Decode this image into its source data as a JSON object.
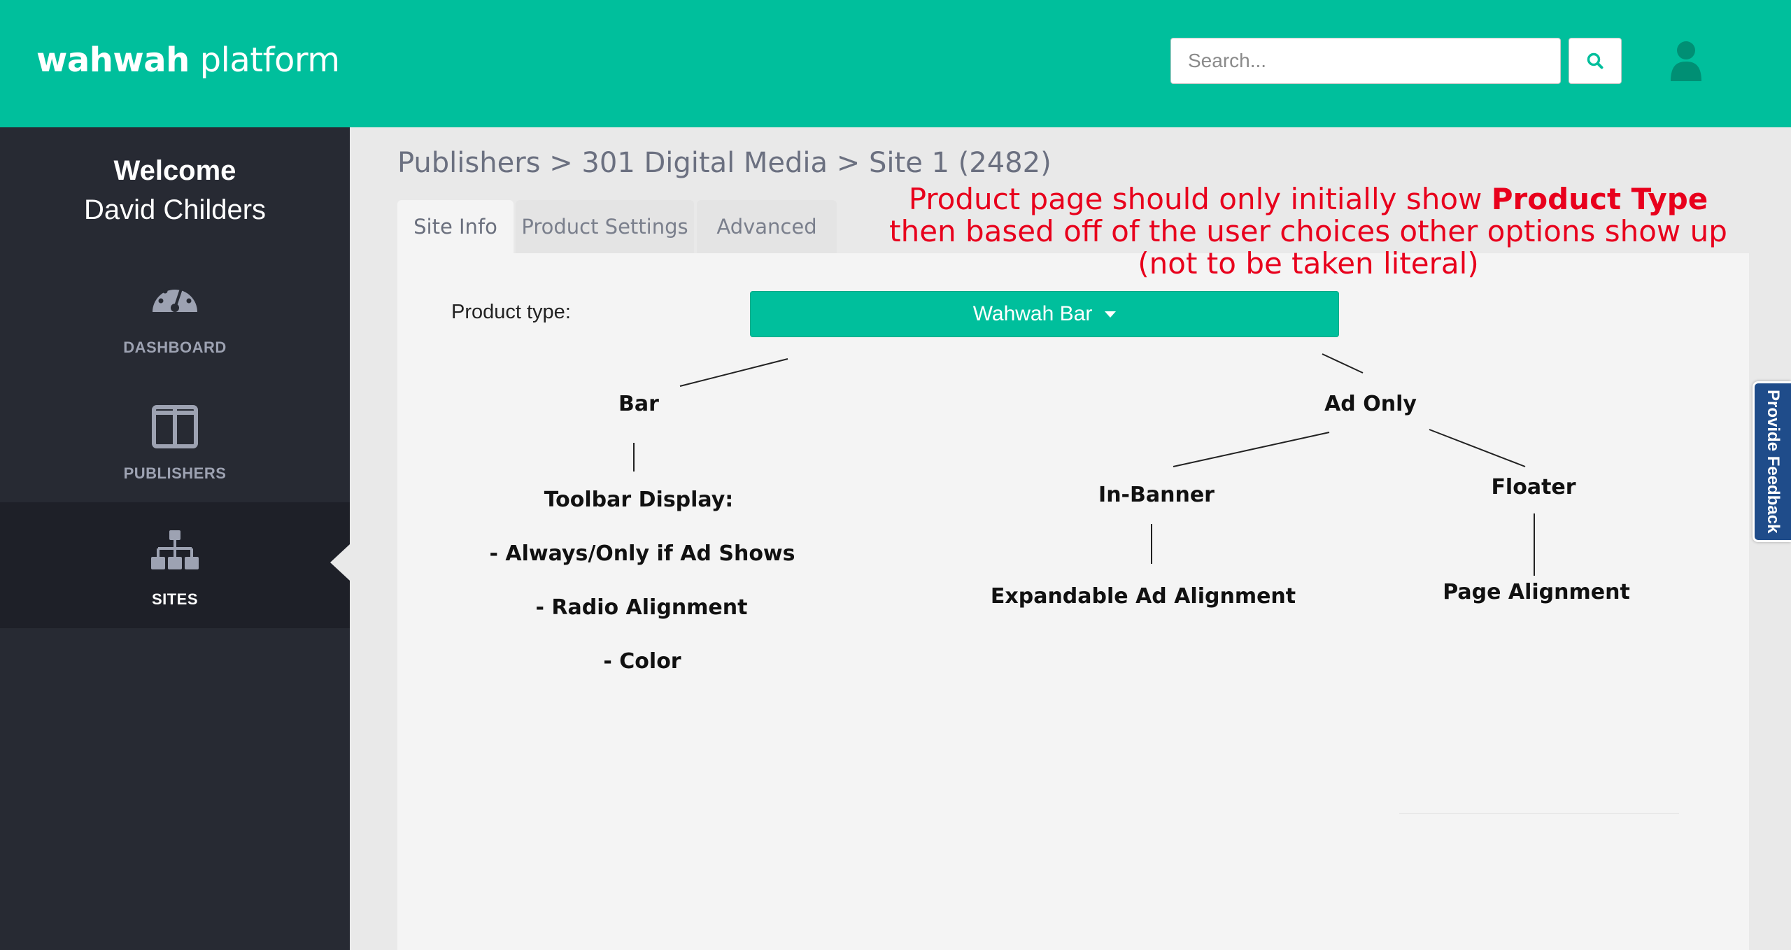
{
  "header": {
    "brand_bold": "wahwah",
    "brand_rest": " platform",
    "search_placeholder": "Search...",
    "search_icon": "search-icon",
    "user_icon": "user-icon",
    "bg_color": "#00bf9c"
  },
  "sidebar": {
    "welcome": "Welcome",
    "user_name": "David Childers",
    "items": [
      {
        "label": "DASHBOARD",
        "icon": "dashboard-gauge-icon",
        "active": false
      },
      {
        "label": "PUBLISHERS",
        "icon": "columns-icon",
        "active": false
      },
      {
        "label": "SITES",
        "icon": "sitemap-icon",
        "active": true
      }
    ],
    "bg_color": "#272a33"
  },
  "breadcrumb": "Publishers > 301 Digital Media > Site 1 (2482)",
  "tabs": [
    {
      "label": "Site Info",
      "active": true
    },
    {
      "label": "Product Settings",
      "active": false
    },
    {
      "label": "Advanced",
      "active": false
    }
  ],
  "form": {
    "product_type_label": "Product type:",
    "product_type_value": "Wahwah Bar"
  },
  "annotation": {
    "line1_pre": "Product page should only initially show ",
    "line1_bold": "Product Type",
    "line2": "then based off of the user choices other options show up",
    "line3": "(not to be taken literal)",
    "color": "#e8001c"
  },
  "tree": {
    "bar": "Bar",
    "ad_only": "Ad Only",
    "toolbar_display": "Toolbar Display:",
    "always_only": "- Always/Only if Ad Shows",
    "radio_alignment": "- Radio Alignment",
    "color": "- Color",
    "in_banner": "In-Banner",
    "floater": "Floater",
    "expandable": "Expandable Ad Alignment",
    "page_alignment": "Page Alignment"
  },
  "feedback": "Provide Feedback"
}
